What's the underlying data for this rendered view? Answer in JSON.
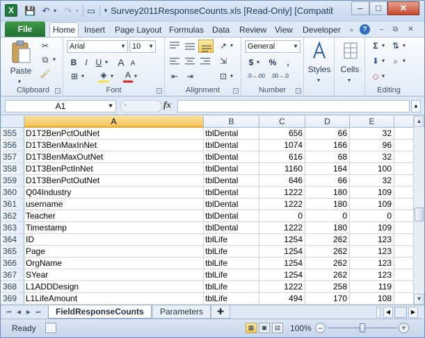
{
  "window": {
    "title": "Survey2011ResponseCounts.xls  [Read-Only]  [Compatibili...",
    "controls": [
      "–",
      "□",
      "✕"
    ]
  },
  "qat": {
    "save": "💾",
    "undo": "↶",
    "redo": "↷",
    "new": "▭",
    "more": "▾"
  },
  "ribbon_tabs": {
    "file": "File",
    "tabs": [
      "Home",
      "Insert",
      "Page Layout",
      "Formulas",
      "Data",
      "Review",
      "View",
      "Developer"
    ],
    "active": "Home"
  },
  "ribbon": {
    "clipboard": {
      "label": "Clipboard",
      "paste": "Paste"
    },
    "font": {
      "label": "Font",
      "font_name": "Arial",
      "font_size": "10",
      "bold": "B",
      "italic": "I",
      "underline": "U",
      "grow": "A",
      "shrink": "A"
    },
    "alignment": {
      "label": "Alignment"
    },
    "number": {
      "label": "Number",
      "format": "General",
      "currency": "$",
      "percent": "%",
      "comma": ",",
      "inc_dec": ".0→.00",
      "dec_dec": ".00→.0"
    },
    "styles": {
      "label": "Styles"
    },
    "cells": {
      "label": "Cells"
    },
    "editing": {
      "label": "Editing",
      "sum": "Σ"
    }
  },
  "formula_bar": {
    "name_box": "A1",
    "fx": "fx",
    "formula": ""
  },
  "columns": [
    "A",
    "B",
    "C",
    "D",
    "E"
  ],
  "selected_column": "A",
  "rows": [
    {
      "n": "355",
      "a": "D1T2BenPctOutNet",
      "b": "tblDental",
      "c": "656",
      "d": "66",
      "e": "32"
    },
    {
      "n": "356",
      "a": "D1T3BenMaxInNet",
      "b": "tblDental",
      "c": "1074",
      "d": "166",
      "e": "96"
    },
    {
      "n": "357",
      "a": "D1T3BenMaxOutNet",
      "b": "tblDental",
      "c": "616",
      "d": "68",
      "e": "32"
    },
    {
      "n": "358",
      "a": "D1T3BenPctInNet",
      "b": "tblDental",
      "c": "1160",
      "d": "164",
      "e": "100"
    },
    {
      "n": "359",
      "a": "D1T3BenPctOutNet",
      "b": "tblDental",
      "c": "646",
      "d": "66",
      "e": "32"
    },
    {
      "n": "360",
      "a": "Q04Industry",
      "b": "tblDental",
      "c": "1222",
      "d": "180",
      "e": "109"
    },
    {
      "n": "361",
      "a": "username",
      "b": "tblDental",
      "c": "1222",
      "d": "180",
      "e": "109"
    },
    {
      "n": "362",
      "a": "Teacher",
      "b": "tblDental",
      "c": "0",
      "d": "0",
      "e": "0"
    },
    {
      "n": "363",
      "a": "Timestamp",
      "b": "tblDental",
      "c": "1222",
      "d": "180",
      "e": "109"
    },
    {
      "n": "364",
      "a": "ID",
      "b": "tblLife",
      "c": "1254",
      "d": "262",
      "e": "123"
    },
    {
      "n": "365",
      "a": "Page",
      "b": "tblLife",
      "c": "1254",
      "d": "262",
      "e": "123"
    },
    {
      "n": "366",
      "a": "OrgName",
      "b": "tblLife",
      "c": "1254",
      "d": "262",
      "e": "123"
    },
    {
      "n": "367",
      "a": "SYear",
      "b": "tblLife",
      "c": "1254",
      "d": "262",
      "e": "123"
    },
    {
      "n": "368",
      "a": "L1ADDDesign",
      "b": "tblLife",
      "c": "1222",
      "d": "258",
      "e": "119"
    },
    {
      "n": "369",
      "a": "L1LifeAmount",
      "b": "tblLife",
      "c": "494",
      "d": "170",
      "e": "108"
    }
  ],
  "sheets": {
    "active": "FieldResponseCounts",
    "other": "Parameters"
  },
  "status": {
    "ready": "Ready",
    "zoom": "100%",
    "zoom_level_percent": 100
  }
}
